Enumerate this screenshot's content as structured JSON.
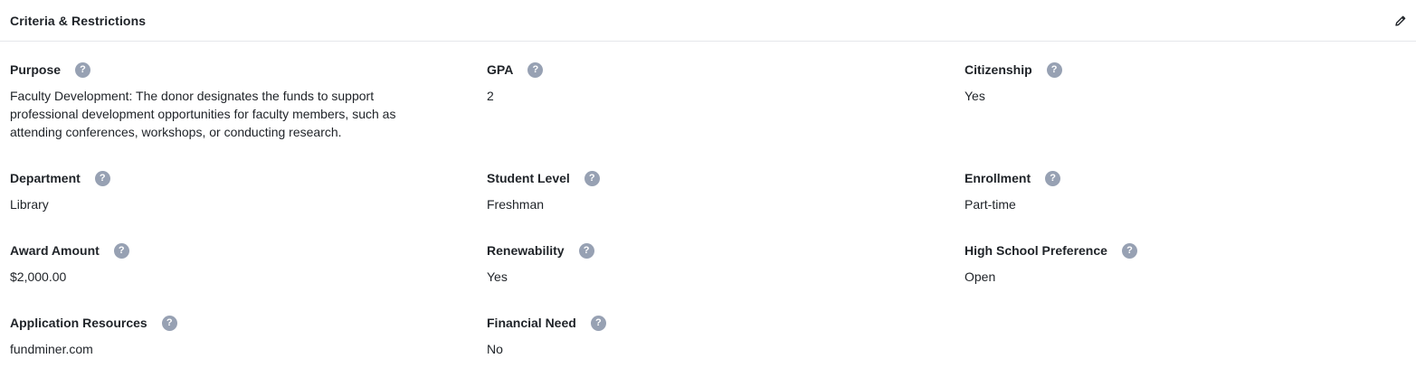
{
  "header": {
    "title": "Criteria & Restrictions",
    "edit_icon": "pencil-icon"
  },
  "fields": [
    {
      "label": "Purpose",
      "value": "Faculty Development: The donor designates the funds to support professional development opportunities for faculty members, such as attending conferences, workshops, or conducting research."
    },
    {
      "label": "GPA",
      "value": "2"
    },
    {
      "label": "Citizenship",
      "value": "Yes"
    },
    {
      "label": "Department",
      "value": "Library"
    },
    {
      "label": "Student Level",
      "value": "Freshman"
    },
    {
      "label": "Enrollment",
      "value": "Part-time"
    },
    {
      "label": "Award Amount",
      "value": "$2,000.00"
    },
    {
      "label": "Renewability",
      "value": "Yes"
    },
    {
      "label": "High School Preference",
      "value": "Open"
    },
    {
      "label": "Application Resources",
      "value": "fundminer.com"
    },
    {
      "label": "Financial Need",
      "value": "No"
    }
  ],
  "help_glyph": "?",
  "colors": {
    "help_icon_bg": "#97a1b3",
    "divider": "#e5e7eb",
    "text": "#1f2328"
  }
}
